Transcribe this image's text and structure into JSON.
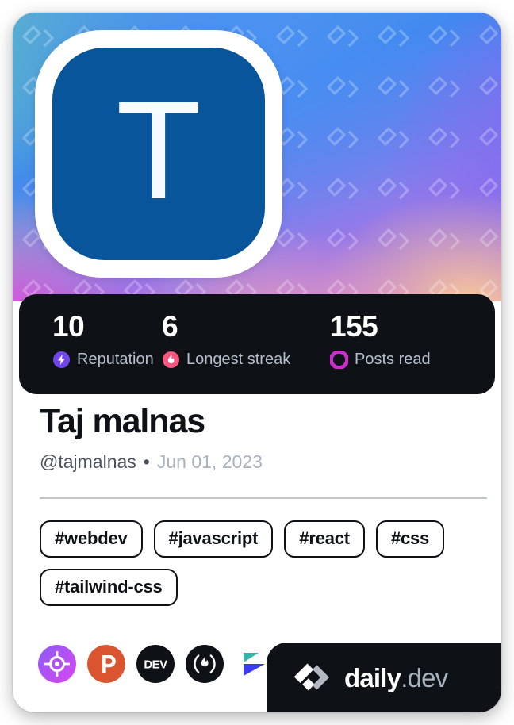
{
  "card": {
    "avatar": {
      "letter": "T",
      "background_color": "#08559b",
      "icon": "avatar-initial"
    },
    "cover": {
      "pattern_icon": "daily-dev-chevron-pattern",
      "gradient_colors": [
        "#5fb2cf",
        "#3f86ef",
        "#8f7bea",
        "#cf63d8",
        "#f6c89a"
      ]
    },
    "stats": [
      {
        "value": "10",
        "label": "Reputation",
        "icon": "reputation-bolt-icon",
        "color": "#7147ed"
      },
      {
        "value": "6",
        "label": "Longest streak",
        "icon": "streak-flame-icon",
        "color": "#f8557f"
      },
      {
        "value": "155",
        "label": "Posts read",
        "icon": "posts-read-ring-icon",
        "color": "#cc2ecc"
      }
    ],
    "profile": {
      "display_name": "Taj malnas",
      "handle": "@tajmalnas",
      "separator": "•",
      "joined": "Jun 01, 2023"
    },
    "tags": [
      "#webdev",
      "#javascript",
      "#react",
      "#css",
      "#tailwind-css"
    ],
    "socials": [
      {
        "name": "codepen-icon",
        "label": "CodePen",
        "color": "#b44ae8"
      },
      {
        "name": "producthunt-icon",
        "label": "Product Hunt",
        "color": "#da552f"
      },
      {
        "name": "devto-icon",
        "label": "DEV",
        "color": "#0e1217"
      },
      {
        "name": "hashnode-icon",
        "label": "Hashnode",
        "color": "#0e1217"
      },
      {
        "name": "polywork-icon",
        "label": "Polywork",
        "color": "#3b3bf5"
      }
    ],
    "brand": {
      "logo_icon": "daily-dev-logo-icon",
      "name": "daily",
      "suffix": ".dev"
    }
  }
}
